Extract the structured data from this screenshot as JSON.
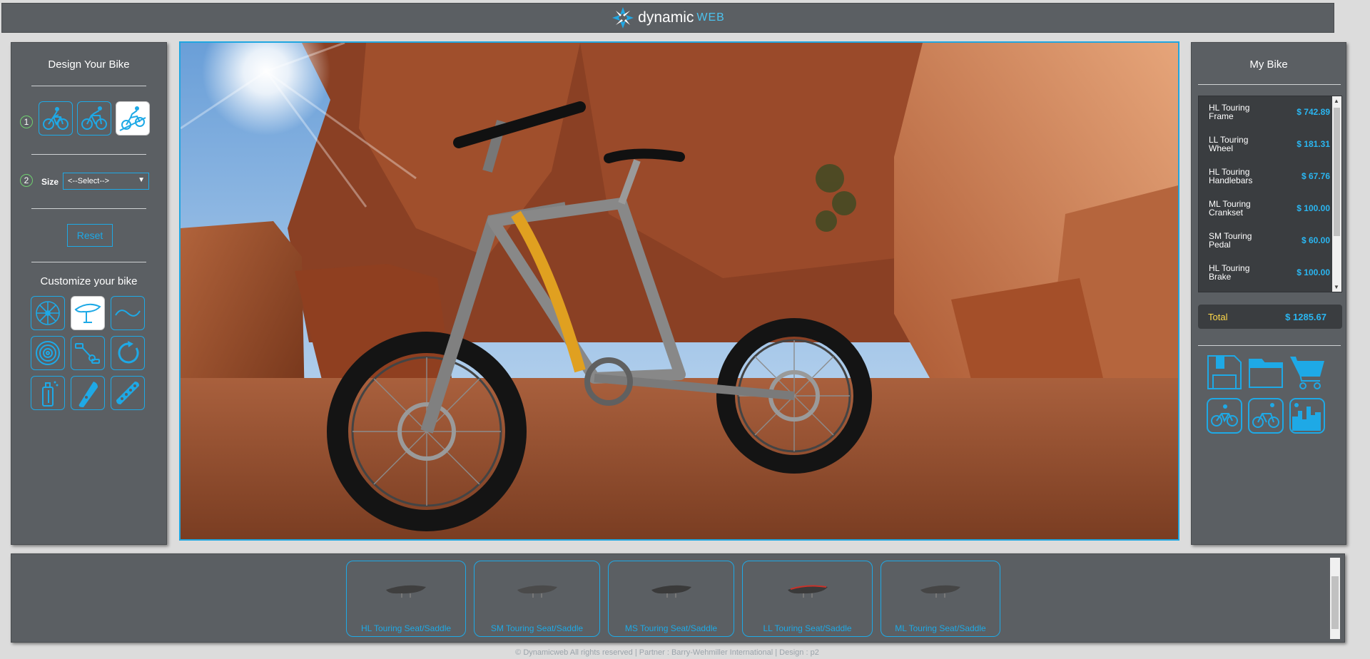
{
  "header": {
    "logo_text": "dynamic",
    "logo_suffix": "WEB"
  },
  "left_panel": {
    "title": "Design Your Bike",
    "step1": "1",
    "step2": "2",
    "size_label": "Size",
    "size_selected": "<--Select-->",
    "reset_label": "Reset",
    "customize_title": "Customize your bike",
    "modes": [
      "mountain-bike-icon",
      "road-bike-icon",
      "trail-bike-icon"
    ],
    "parts": [
      "wheel-icon",
      "saddle-icon",
      "handlebar-icon",
      "tire-icon",
      "pedal-icon",
      "brake-icon",
      "bottle-icon",
      "frame-icon",
      "chain-icon"
    ]
  },
  "right_panel": {
    "title": "My Bike",
    "items": [
      {
        "name": "HL Touring Frame",
        "price": "$ 742.89"
      },
      {
        "name": "LL Touring Wheel",
        "price": "$ 181.31"
      },
      {
        "name": "HL Touring Handlebars",
        "price": "$ 67.76"
      },
      {
        "name": "ML Touring Crankset",
        "price": "$ 100.00"
      },
      {
        "name": "SM Touring Pedal",
        "price": "$ 60.00"
      },
      {
        "name": "HL Touring Brake",
        "price": "$ 100.00"
      }
    ],
    "total_label": "Total",
    "total_value": "$ 1285.67"
  },
  "saddles": [
    {
      "label": "HL Touring Seat/Saddle"
    },
    {
      "label": "SM Touring Seat/Saddle"
    },
    {
      "label": "MS Touring Seat/Saddle"
    },
    {
      "label": "LL Touring Seat/Saddle"
    },
    {
      "label": "ML Touring Seat/Saddle"
    }
  ],
  "footer": {
    "text": "© Dynamicweb All rights reserved | Partner : Barry-Wehmiller International | Design : p2"
  },
  "colors": {
    "accent": "#1ea9e6",
    "panel": "#5b5f63",
    "total_label": "#ffd84a"
  }
}
